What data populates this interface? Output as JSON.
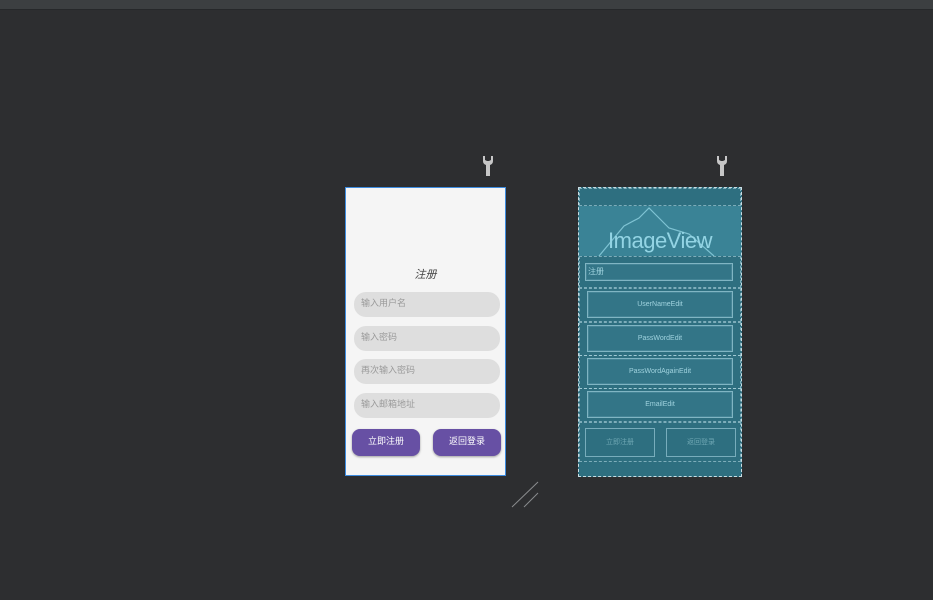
{
  "design": {
    "title": "注册",
    "fields": [
      {
        "placeholder": "输入用户名"
      },
      {
        "placeholder": "输入密码"
      },
      {
        "placeholder": "再次输入密码"
      },
      {
        "placeholder": "输入邮箱地址"
      }
    ],
    "buttons": {
      "register": "立即注册",
      "back": "返回登录"
    },
    "button_color": "#6750a4",
    "frame_color": "#3d8ce0"
  },
  "blueprint": {
    "imageview_label": "ImageView",
    "title": "注册",
    "fields": [
      "UserNameEdit",
      "PassWordEdit",
      "PassWordAgainEdit",
      "EmailEdit"
    ],
    "buttons": {
      "register": "立即注册",
      "back": "返回登录"
    },
    "background_color": "#2e6f80"
  },
  "icons": {
    "design_tools": "wrench-icon",
    "blueprint_tools": "wrench-icon",
    "resize": "resize-handle-icon"
  }
}
